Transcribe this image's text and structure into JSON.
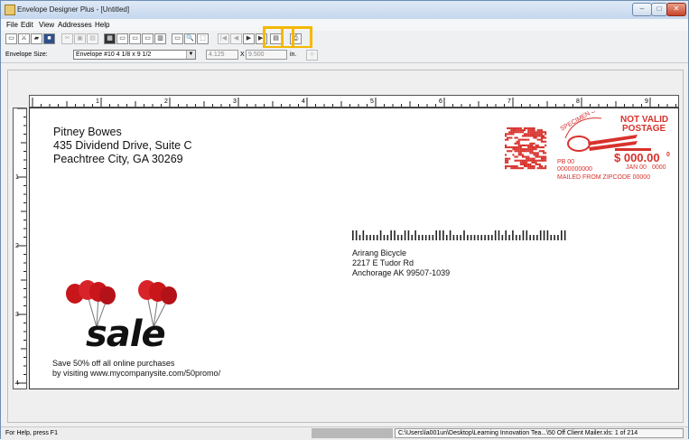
{
  "window": {
    "title": "Envelope Designer Plus - [Untitled]",
    "controls": {
      "minimize": "–",
      "maximize": "□",
      "close": "✕"
    }
  },
  "menu": [
    "File",
    "Edit",
    "View",
    "Addresses",
    "Help"
  ],
  "toolbar_icons": [
    "new-icon",
    "wizard-icon",
    "open-icon",
    "save-icon",
    "cut-icon",
    "copy-icon",
    "paste-icon",
    "envelope-icon",
    "text-box-icon",
    "barcode-box-icon",
    "image-box-icon",
    "postnet-icon",
    "rectangle-icon",
    "zoom-icon",
    "fit-page-icon",
    "first-record-icon",
    "previous-record-icon",
    "next-record-icon",
    "last-record-icon",
    "print-preview-icon",
    "print-icon"
  ],
  "sizebar": {
    "envelope_size_label": "Envelope Size:",
    "envelope_size_value": "Envelope #10 4 1/8 x 9 1/2",
    "width_value": "4.125",
    "x_label": "X",
    "height_value": "9.500",
    "unit_label": "in."
  },
  "ruler": {
    "h_marks": [
      "1",
      "2",
      "3",
      "4",
      "5",
      "6",
      "7",
      "8",
      "9"
    ],
    "v_marks": [
      "1",
      "2",
      "3",
      "4"
    ]
  },
  "envelope": {
    "sender": [
      "Pitney Bowes",
      "435 Dividend Drive, Suite C",
      "Peachtree City, GA 30269"
    ],
    "recipient": [
      "Arirang Bicycle",
      "2217 E Tudor Rd",
      "Anchorage AK 99507-1039"
    ],
    "promo": [
      "Save 50% off all online purchases",
      "by visiting www.mycompanysite.com/50promo/"
    ],
    "sale_text": "sale",
    "postage": {
      "not_valid": "NOT VALID",
      "postage_word": "POSTAGE",
      "specimen": "SPECIMEN SPECIMEN",
      "amount": "$ 000.00",
      "amount_sup": "0",
      "pb": "PB 00",
      "date": "JAN 00",
      "code1": "0000000000",
      "code2": "0000",
      "mailed_from": "MAILED FROM ZIPCODE 00000",
      "color": "#d8322c"
    }
  },
  "status": {
    "help_text": "For Help, press F1",
    "path_text": "C:\\Users\\la001un\\Desktop\\Learning Innovation Tea...\\50 Off Client Mailer.xls: 1 of 214"
  },
  "colors": {
    "highlight": "#f5b800",
    "postage_red": "#d8322c"
  }
}
